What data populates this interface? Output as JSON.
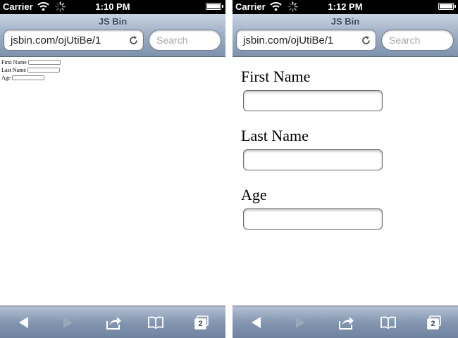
{
  "screens": [
    {
      "status": {
        "carrier": "Carrier",
        "time": "1:10 PM"
      },
      "browser": {
        "title": "JS Bin",
        "url": "jsbin.com/ojUtiBe/1",
        "search_placeholder": "Search"
      },
      "form": {
        "first_name_label": "First Name",
        "last_name_label": "Last Name",
        "age_label": "Age"
      },
      "toolbar": {
        "tabs_count": "2"
      }
    },
    {
      "status": {
        "carrier": "Carrier",
        "time": "1:12 PM"
      },
      "browser": {
        "title": "JS Bin",
        "url": "jsbin.com/ojUtiBe/1",
        "search_placeholder": "Search"
      },
      "form": {
        "first_name_label": "First Name",
        "last_name_label": "Last Name",
        "age_label": "Age"
      },
      "toolbar": {
        "tabs_count": "2"
      }
    }
  ],
  "colors": {
    "status_bar": "#000000",
    "nav_gradient_top": "#c8d3e2",
    "nav_gradient_bottom": "#7f92ad",
    "toolbar_icon": "#ffffff"
  },
  "icons": [
    "wifi-icon",
    "activity-spinner-icon",
    "battery-icon",
    "reload-icon",
    "back-arrow-icon",
    "forward-arrow-icon",
    "share-icon",
    "bookmarks-icon",
    "tabs-icon"
  ]
}
